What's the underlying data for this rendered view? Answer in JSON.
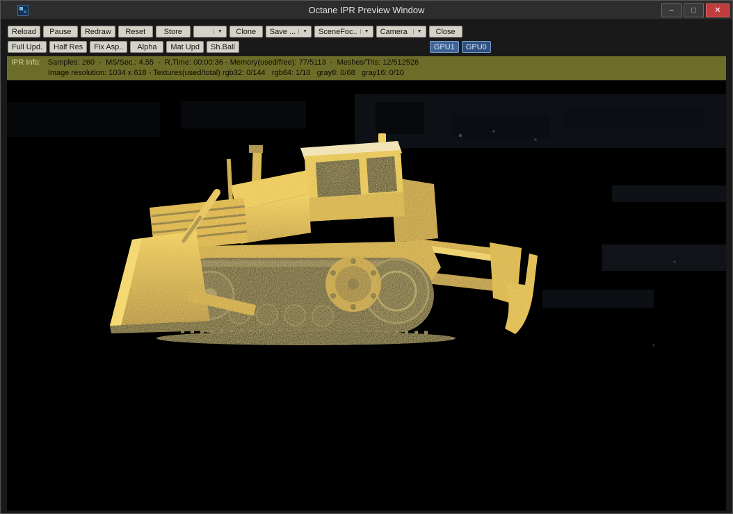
{
  "window": {
    "title": "Octane IPR Preview Window",
    "controls": {
      "minimize": "–",
      "maximize": "□",
      "close": "✕"
    }
  },
  "icons": {
    "dropdown_arrow": "▼"
  },
  "toolbar": {
    "row1": [
      {
        "label": "Reload"
      },
      {
        "label": "Pause"
      },
      {
        "label": "Redraw"
      },
      {
        "label": "Reset"
      },
      {
        "label": "Store"
      },
      {
        "label": ""
      },
      {
        "label": "Clone"
      },
      {
        "label": "Save ..."
      },
      {
        "label": "SceneFoc.."
      },
      {
        "label": "Camera"
      },
      {
        "label": "Close"
      }
    ],
    "row2": [
      {
        "label": "Full Upd."
      },
      {
        "label": "Half Res"
      },
      {
        "label": "Fix Asp.."
      },
      {
        "label": "Alpha"
      },
      {
        "label": "Mat Upd"
      },
      {
        "label": "Sh.Ball"
      }
    ],
    "gpu": [
      {
        "label": "GPU1"
      },
      {
        "label": "GPU0"
      }
    ]
  },
  "info": {
    "label": "IPR Info:",
    "line1": "Samples: 260  -  MS/Sec.: 4.55  -  R.Time: 00:00:36 - Memory(used/free): 77/5113  -  Meshes/Tris: 12/512526",
    "line2": "Image resolution: 1034 x 618 - Textures(used/total) rgb32: 0/144   rgb64: 1/10   gray8: 0/68   gray16: 0/10"
  },
  "render": {
    "subject": "yellow bulldozer (in-progress path-traced render with grain)",
    "background": "dark industrial night scene, barely visible",
    "resolution_text": "1034 x 618"
  },
  "colors": {
    "titlebar_bg": "#2d2d2d",
    "toolbar_bg": "#191919",
    "button_bg": "#d5d2ca",
    "gpu_button_bg": "#3f6392",
    "info_bg": "#6d6d2a",
    "close_red": "#bf3d3d",
    "dozer_yellow": "#e2bd42"
  }
}
